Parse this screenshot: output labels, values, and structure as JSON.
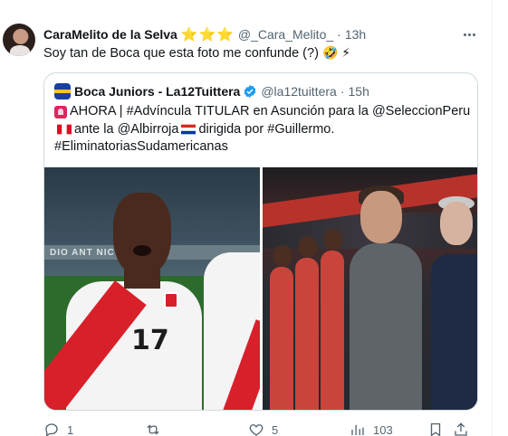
{
  "tweet": {
    "display_name": "CaraMelito de la Selva",
    "badge": "⭐⭐⭐",
    "handle": "@_Cara_Melito_",
    "separator": "·",
    "time": "13h",
    "text": "Soy tan de Boca que esta foto me confunde (?)",
    "emojis": "🤣 ⚡"
  },
  "quote": {
    "display_name": "Boca Juniors - La12Tuittera",
    "handle": "@la12tuittera",
    "separator": "·",
    "time": "15h",
    "line1": "AHORA | #Advíncula TITULAR en Asunción para la @SeleccionPeru",
    "line2a": "ante la @Albirroja",
    "line2b": "dirigida por #Guillermo.",
    "line3": "#EliminatoriasSudamericanas",
    "media": {
      "left_photo_ad_text": "DIO ANT  NICO",
      "left_photo_jersey_number": "17",
      "left_photo_description_icon": "player-photo",
      "right_photo_description_icon": "coach-photo"
    }
  },
  "actions": {
    "reply_count": "1",
    "retweet_count": "",
    "like_count": "5",
    "view_count": "103"
  },
  "colors": {
    "text_primary": "#0f1419",
    "text_secondary": "#536471",
    "border": "#cfd9de",
    "verified": "#1d9bf0",
    "star": "#f5b50a"
  }
}
